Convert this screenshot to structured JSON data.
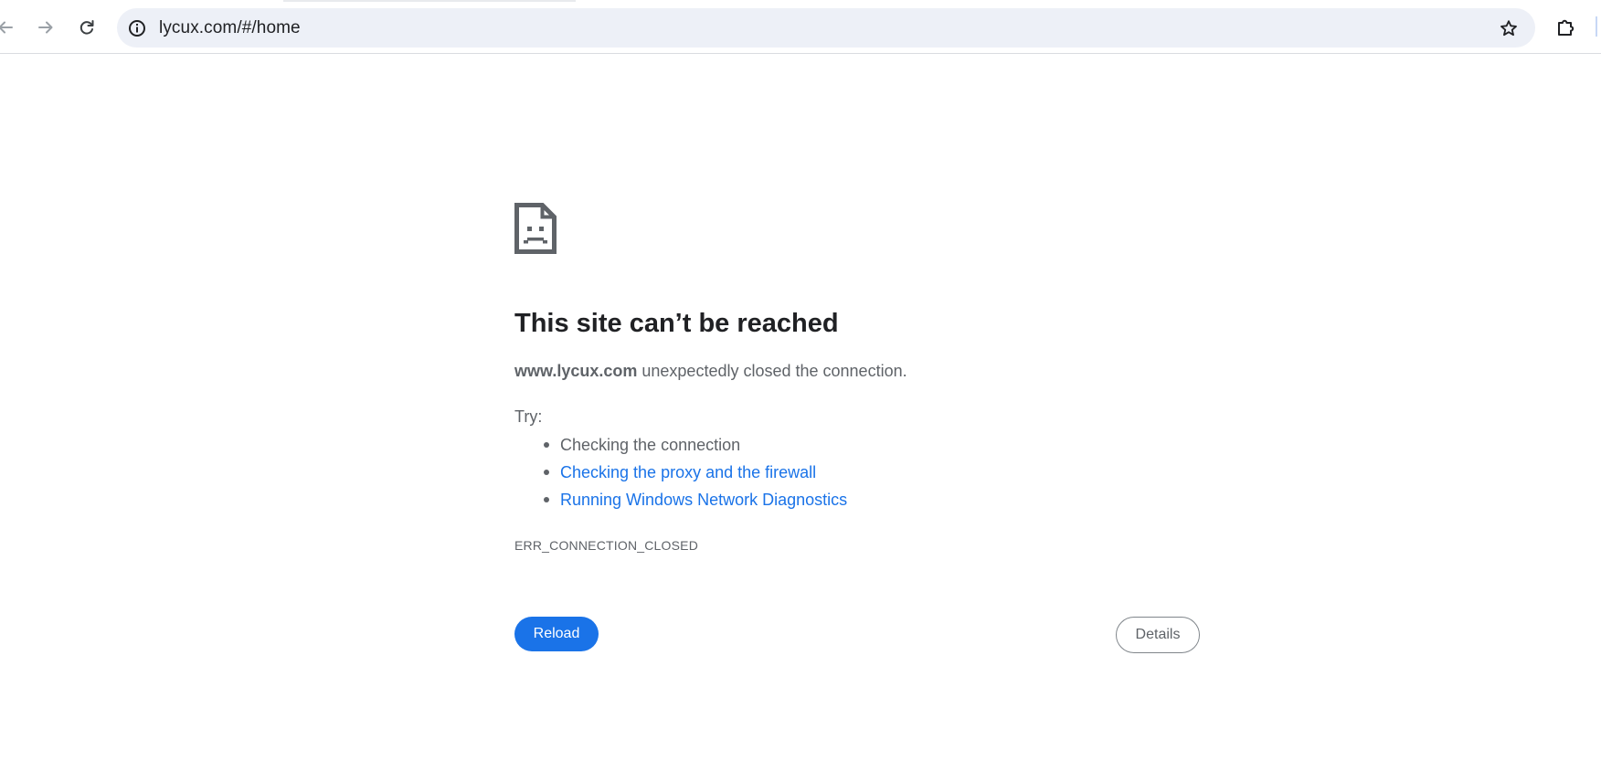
{
  "browser": {
    "url": "lycux.com/#/home",
    "icons": {
      "back": "arrow-left-icon",
      "forward": "arrow-right-icon",
      "reload": "reload-icon",
      "site_info": "info-icon",
      "bookmark": "star-icon",
      "extensions": "puzzle-icon"
    }
  },
  "error_page": {
    "icon": "sad-document-icon",
    "title": "This site can’t be reached",
    "summary_host": "www.lycux.com",
    "summary_text": " unexpectedly closed the connection.",
    "try_label": "Try:",
    "suggestions": [
      {
        "text": "Checking the connection",
        "is_link": false
      },
      {
        "text": "Checking the proxy and the firewall",
        "is_link": true
      },
      {
        "text": "Running Windows Network Diagnostics",
        "is_link": true
      }
    ],
    "error_code": "ERR_CONNECTION_CLOSED",
    "reload_label": "Reload",
    "details_label": "Details"
  },
  "colors": {
    "accent": "#1a73e8",
    "text_primary": "#202124",
    "text_secondary": "#5f6368",
    "omnibox_bg": "#edf0f7"
  }
}
